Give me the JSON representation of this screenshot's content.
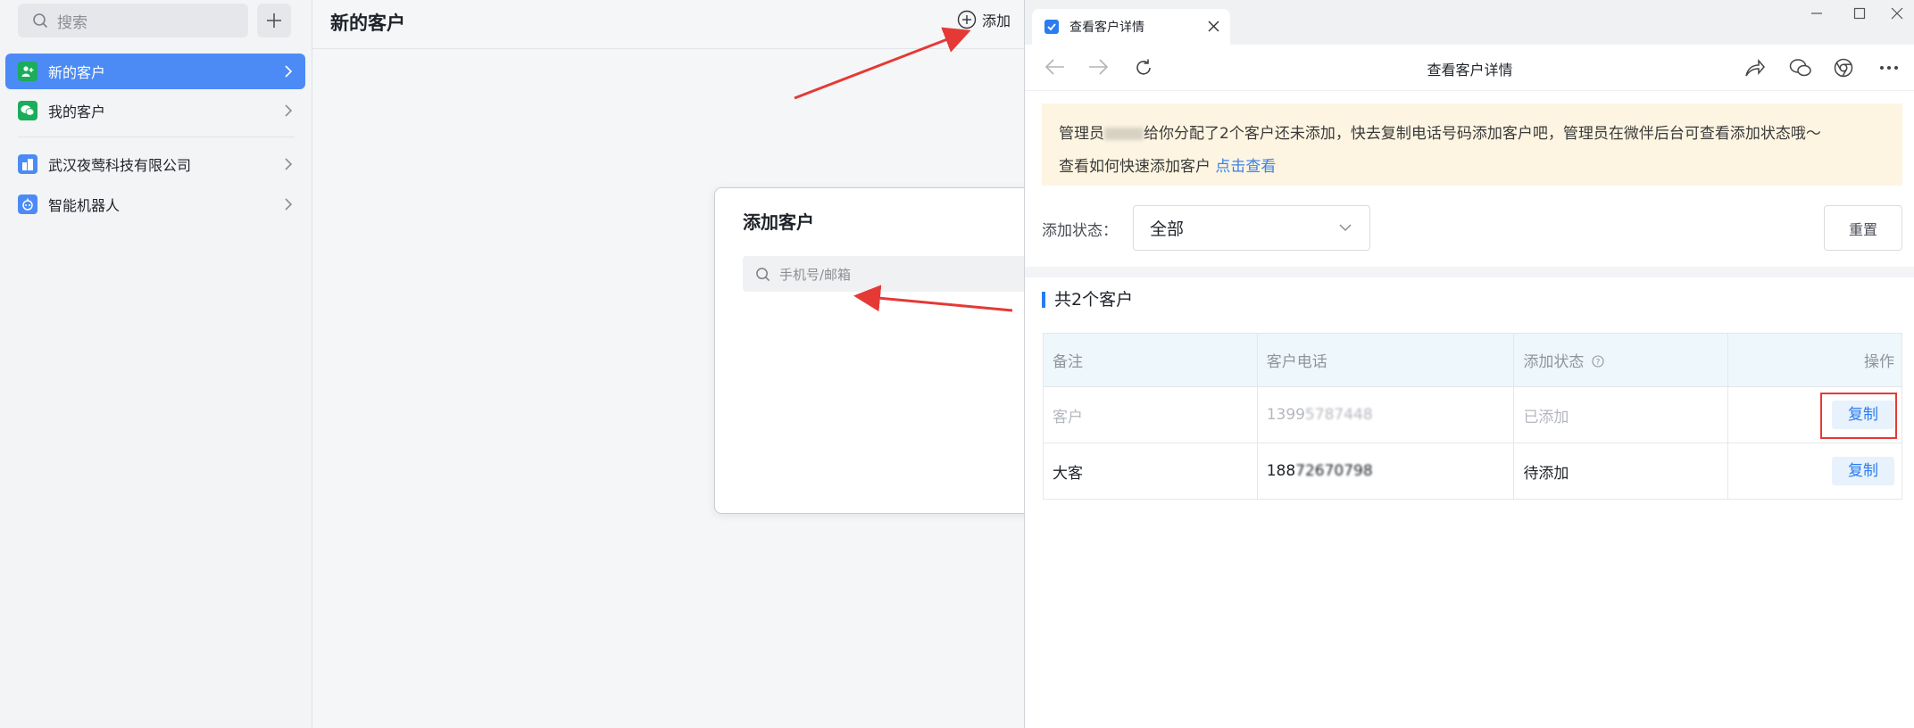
{
  "sidebar": {
    "search_placeholder": "搜索",
    "items": [
      {
        "label": "新的客户",
        "icon": "add-user-icon",
        "color": "#1aad5b"
      },
      {
        "label": "我的客户",
        "icon": "wechat-icon",
        "color": "#1aad5b"
      },
      {
        "label": "武汉夜莺科技有限公司",
        "icon": "building-icon",
        "color": "#4c8bf5"
      },
      {
        "label": "智能机器人",
        "icon": "robot-icon",
        "color": "#4c8bf5"
      }
    ]
  },
  "middle": {
    "title": "新的客户",
    "add_label": "添加"
  },
  "dialog": {
    "title": "添加客户",
    "search_placeholder": "手机号/邮箱"
  },
  "browser": {
    "tab_title": "查看客户详情",
    "page_title": "查看客户详情",
    "notice": {
      "line1_prefix": "管理员",
      "line1_suffix": "给你分配了2个客户还未添加，快去复制电话号码添加客户吧，管理员在微伴后台可查看添加状态哦～",
      "line2_text": "查看如何快速添加客户",
      "line2_link": "点击查看"
    },
    "filter": {
      "label": "添加状态：",
      "value": "全部",
      "reset_label": "重置"
    },
    "count_title": "共2个客户",
    "table": {
      "headers": [
        "备注",
        "客户电话",
        "添加状态",
        "操作"
      ],
      "rows": [
        {
          "note": "客户",
          "phone_prefix": "1399",
          "phone_hidden": "5787448",
          "status": "已添加",
          "action": "复制"
        },
        {
          "note": "大客",
          "phone_prefix": "188",
          "phone_hidden": "72670798",
          "status": "待添加",
          "action": "复制"
        }
      ]
    }
  },
  "colors": {
    "accent": "#4c8bf5",
    "link": "#3b82e8",
    "highlight": "#e53935",
    "notice_bg": "#fdf5e2"
  }
}
